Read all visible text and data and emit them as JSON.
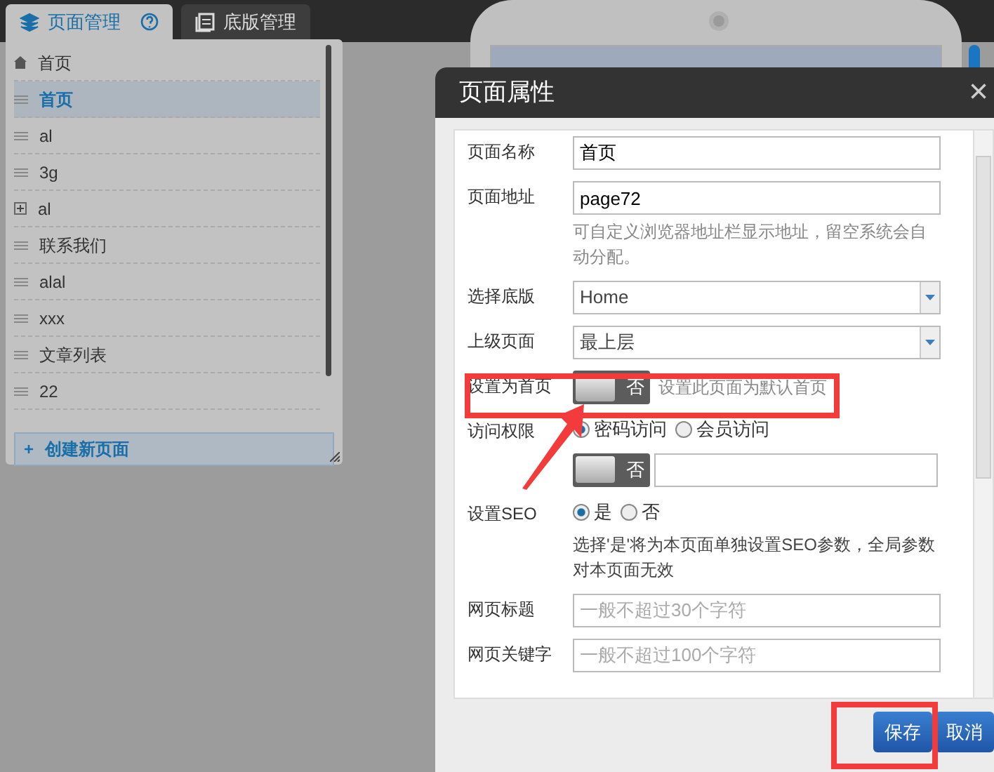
{
  "panel_tabs": [
    {
      "label": "页面管理",
      "selected": true,
      "help": true
    },
    {
      "label": "底版管理",
      "selected": false,
      "help": false
    }
  ],
  "pages": [
    {
      "label": "首页",
      "kind": "home",
      "selected": false
    },
    {
      "label": "首页",
      "kind": "drag",
      "selected": true
    },
    {
      "label": "al",
      "kind": "drag",
      "selected": false
    },
    {
      "label": "3g",
      "kind": "drag",
      "selected": false
    },
    {
      "label": "al",
      "kind": "expand",
      "selected": false
    },
    {
      "label": "联系我们",
      "kind": "drag",
      "selected": false
    },
    {
      "label": "alal",
      "kind": "drag",
      "selected": false
    },
    {
      "label": "xxx",
      "kind": "drag",
      "selected": false
    },
    {
      "label": "文章列表",
      "kind": "drag",
      "selected": false
    },
    {
      "label": "22",
      "kind": "drag",
      "selected": false
    }
  ],
  "create_button": {
    "icon": "+",
    "label": "创建新页面"
  },
  "dialog": {
    "title": "页面属性",
    "close": "×",
    "fields": [
      {
        "kind": "text",
        "label": "页面名称",
        "value": "首页"
      },
      {
        "kind": "text",
        "label": "页面地址",
        "value": "page72",
        "hint": "可自定义浏览器地址栏显示地址，留空系统会自动分配。"
      },
      {
        "kind": "select",
        "label": "选择底版",
        "value": "Home"
      },
      {
        "kind": "select",
        "label": "上级页面",
        "value": "最上层"
      },
      {
        "kind": "toggle",
        "label": "设置为首页",
        "toggle": {
          "on": false,
          "off_label": "否"
        },
        "hint": "设置此页面为默认首页"
      },
      {
        "kind": "access",
        "label": "访问权限",
        "options": [
          {
            "label": "密码访问",
            "selected": true
          },
          {
            "label": "会员访问",
            "selected": false
          }
        ],
        "toggle": {
          "on": false,
          "off_label": "否"
        }
      },
      {
        "kind": "radio",
        "label": "设置SEO",
        "options": [
          {
            "label": "是",
            "selected": true
          },
          {
            "label": "否",
            "selected": false
          }
        ],
        "hint": "选择'是'将为本页面单独设置SEO参数，全局参数对本页面无效"
      },
      {
        "kind": "text",
        "label": "网页标题",
        "placeholder": "一般不超过30个字符"
      },
      {
        "kind": "text",
        "label": "网页关键字",
        "placeholder": "一般不超过100个字符"
      }
    ],
    "buttons": [
      {
        "label": "保存",
        "kind": "primary"
      },
      {
        "label": "取消",
        "kind": "primary"
      }
    ]
  }
}
